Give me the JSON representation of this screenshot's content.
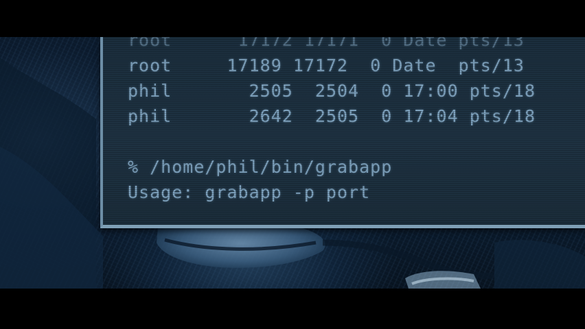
{
  "terminal": {
    "process_lines": [
      {
        "user": "root",
        "pid": "17189",
        "ppid": "17172",
        "c": "0",
        "stime": "Date",
        "tty": "pts/13"
      },
      {
        "user": "phil",
        "pid": "2505",
        "ppid": "2504",
        "c": "0",
        "stime": "17:00",
        "tty": "pts/18"
      },
      {
        "user": "phil",
        "pid": "2642",
        "ppid": "2505",
        "c": "0",
        "stime": "17:04",
        "tty": "pts/18"
      }
    ],
    "prompt": "%",
    "command": "/home/phil/bin/grabapp",
    "usage": "Usage: grabapp -p port"
  },
  "colors": {
    "terminal_text": "#7fa3bf",
    "terminal_bg": "#1e3242",
    "frame_border": "#7f9fb6"
  }
}
